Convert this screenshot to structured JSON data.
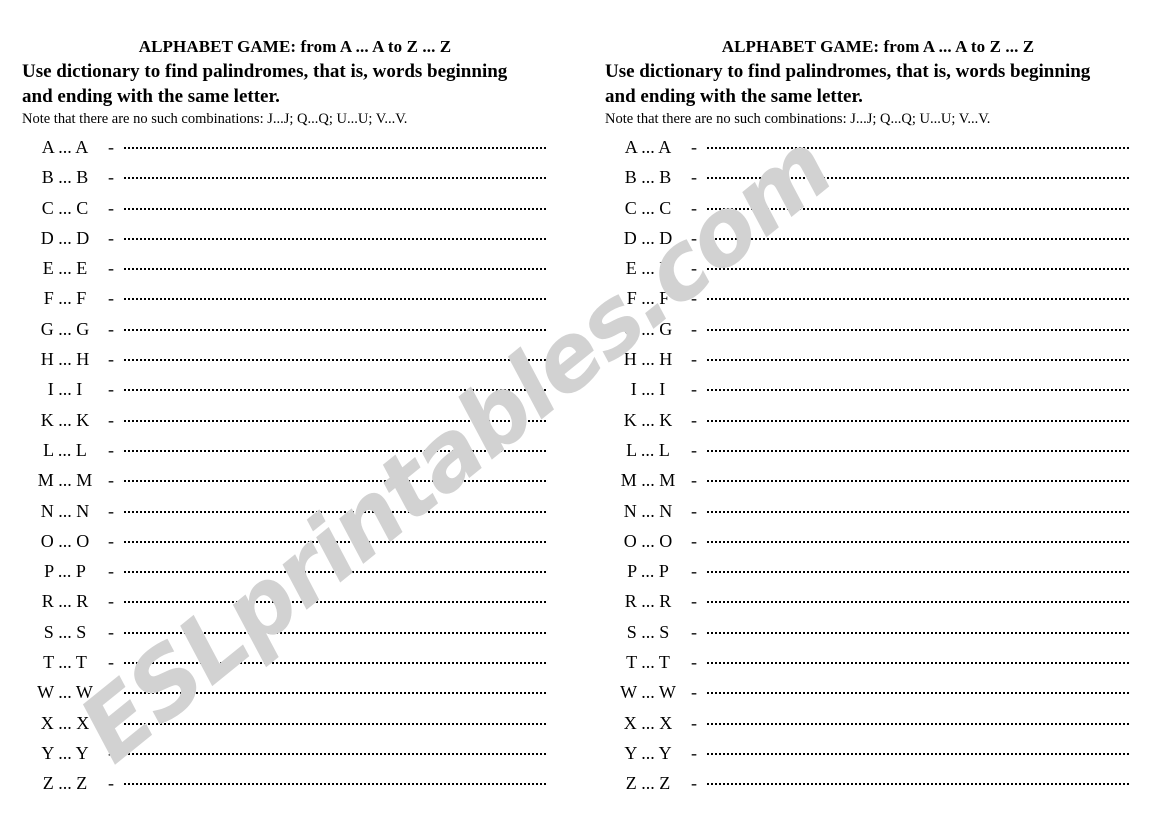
{
  "worksheet": {
    "title": "ALPHABET GAME: from A ... A to Z ... Z",
    "instructions_line1": "Use dictionary to find ",
    "instructions_bold": "palindromes",
    "instructions_line1_tail": ", that is, words beginning",
    "instructions_line2": "and ending with the same letter.",
    "note": "Note that there are no such combinations: J...J; Q...Q; U...U; V...V.",
    "dash": "-",
    "blank_placeholder": "",
    "rows": [
      {
        "letter": "A",
        "label": "A ... A"
      },
      {
        "letter": "B",
        "label": "B ... B"
      },
      {
        "letter": "C",
        "label": "C ... C"
      },
      {
        "letter": "D",
        "label": "D ... D"
      },
      {
        "letter": "E",
        "label": "E ... E"
      },
      {
        "letter": "F",
        "label": "F ... F"
      },
      {
        "letter": "G",
        "label": "G ... G"
      },
      {
        "letter": "H",
        "label": "H ... H"
      },
      {
        "letter": "I",
        "label": "I ... I"
      },
      {
        "letter": "K",
        "label": "K ... K"
      },
      {
        "letter": "L",
        "label": "L ... L"
      },
      {
        "letter": "M",
        "label": "M ... M"
      },
      {
        "letter": "N",
        "label": "N ... N"
      },
      {
        "letter": "O",
        "label": "O ... O"
      },
      {
        "letter": "P",
        "label": "P ... P"
      },
      {
        "letter": "R",
        "label": "R ... R"
      },
      {
        "letter": "S",
        "label": "S ... S"
      },
      {
        "letter": "T",
        "label": "T ... T"
      },
      {
        "letter": "W",
        "label": "W ... W"
      },
      {
        "letter": "X",
        "label": "X ... X"
      },
      {
        "letter": "Y",
        "label": "Y ... Y"
      },
      {
        "letter": "Z",
        "label": "Z ... Z"
      }
    ],
    "excluded_letters": [
      "J",
      "Q",
      "U",
      "V"
    ],
    "row_count": 22,
    "column_count": 2
  },
  "watermark": {
    "text": "ESLprintables.com",
    "color": "#d2d2d2"
  },
  "colors": {
    "page_background": "#ffffff",
    "text": "#000000",
    "dotted_rule": "#000000",
    "watermark": "#d2d2d2"
  }
}
